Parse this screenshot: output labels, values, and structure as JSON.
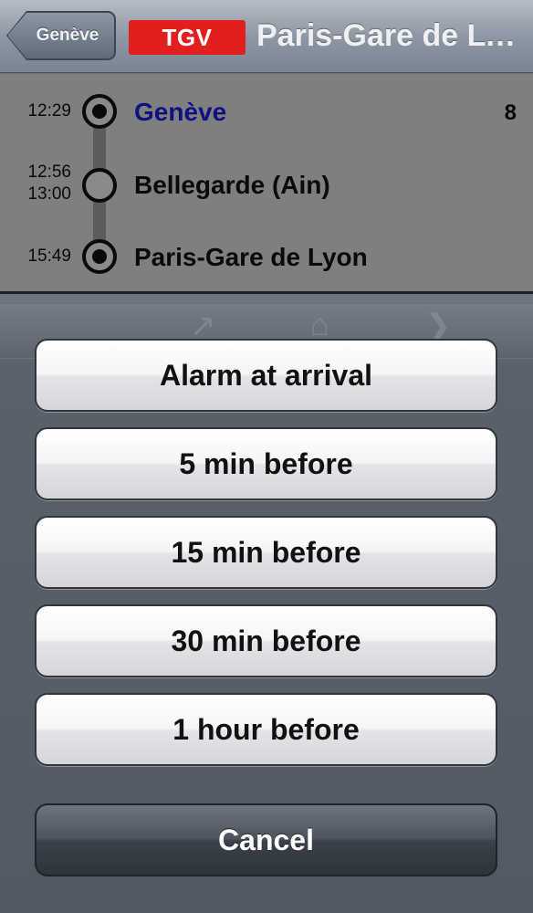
{
  "nav": {
    "back_label": "Genève",
    "train_type": "TGV",
    "title": "Paris-Gare de Lyon",
    "colors": {
      "badge": "#e11f1f",
      "origin_text": "#101080"
    }
  },
  "stops": [
    {
      "times": [
        "12:29"
      ],
      "name": "Genève",
      "platform": "8",
      "marker": "filled"
    },
    {
      "times": [
        "12:56",
        "13:00"
      ],
      "name": "Bellegarde (Ain)",
      "platform": "",
      "marker": "hollow"
    },
    {
      "times": [
        "15:49"
      ],
      "name": "Paris-Gare de Lyon",
      "platform": "",
      "marker": "filled"
    }
  ],
  "toolbar_icons": [
    "share-icon",
    "home-icon",
    "forward-icon"
  ],
  "alarm_sheet": {
    "options": [
      "Alarm at arrival",
      "5 min before",
      "15 min before",
      "30 min before",
      "1 hour before"
    ],
    "cancel_label": "Cancel"
  }
}
